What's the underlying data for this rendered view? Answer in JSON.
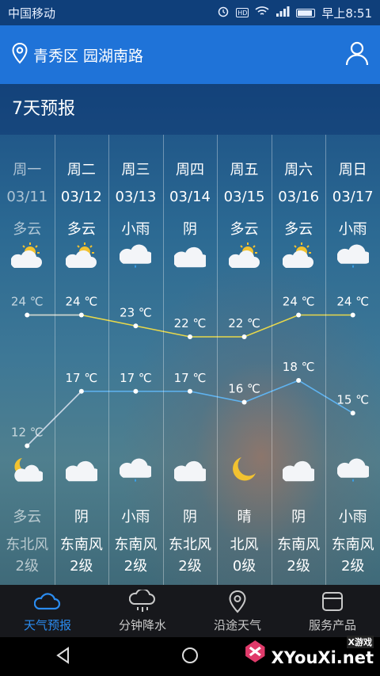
{
  "status": {
    "carrier": "中国移动",
    "time": "早上8:51"
  },
  "header": {
    "location": "青秀区 园湖南路"
  },
  "section_title": "7天预报",
  "days": [
    {
      "day": "周一",
      "date": "03/11",
      "cond": "多云",
      "icon": "partly-cloudy-icon",
      "high": "24 ℃",
      "low": "12 ℃",
      "night_cond": "多云",
      "night_icon": "moon-cloud-icon",
      "wind": "东北风",
      "level": "2级",
      "dim": true
    },
    {
      "day": "周二",
      "date": "03/12",
      "cond": "多云",
      "icon": "partly-cloudy-icon",
      "high": "24 ℃",
      "low": "17 ℃",
      "night_cond": "阴",
      "night_icon": "cloud-icon",
      "wind": "东南风",
      "level": "2级",
      "dim": false
    },
    {
      "day": "周三",
      "date": "03/13",
      "cond": "小雨",
      "icon": "rain-cloud-icon",
      "high": "23 ℃",
      "low": "17 ℃",
      "night_cond": "小雨",
      "night_icon": "rain-cloud-icon",
      "wind": "东南风",
      "level": "2级",
      "dim": false
    },
    {
      "day": "周四",
      "date": "03/14",
      "cond": "阴",
      "icon": "cloud-icon",
      "high": "22 ℃",
      "low": "17 ℃",
      "night_cond": "阴",
      "night_icon": "cloud-icon",
      "wind": "东北风",
      "level": "2级",
      "dim": false
    },
    {
      "day": "周五",
      "date": "03/15",
      "cond": "多云",
      "icon": "partly-cloudy-icon",
      "high": "22 ℃",
      "low": "16 ℃",
      "night_cond": "晴",
      "night_icon": "moon-icon",
      "wind": "北风",
      "level": "0级",
      "dim": false
    },
    {
      "day": "周六",
      "date": "03/16",
      "cond": "多云",
      "icon": "partly-cloudy-icon",
      "high": "24 ℃",
      "low": "18 ℃",
      "night_cond": "阴",
      "night_icon": "cloud-icon",
      "wind": "东南风",
      "level": "2级",
      "dim": false
    },
    {
      "day": "周日",
      "date": "03/17",
      "cond": "小雨",
      "icon": "rain-cloud-icon",
      "high": "24 ℃",
      "low": "15 ℃",
      "night_cond": "小雨",
      "night_icon": "rain-cloud-icon",
      "wind": "东南风",
      "level": "2级",
      "dim": false
    }
  ],
  "chart_data": {
    "type": "line",
    "categories": [
      "周一",
      "周二",
      "周三",
      "周四",
      "周五",
      "周六",
      "周日"
    ],
    "series": [
      {
        "values": [
          24,
          24,
          23,
          22,
          22,
          24,
          24
        ],
        "color": "#e8d84a"
      },
      {
        "values": [
          12,
          17,
          17,
          17,
          16,
          18,
          15
        ],
        "color": "#5fb3f0"
      }
    ],
    "ylim": [
      10,
      26
    ]
  },
  "tabs": [
    {
      "label": "天气预报",
      "icon": "weather-cloud-icon",
      "active": true
    },
    {
      "label": "分钟降水",
      "icon": "rain-cloud-icon",
      "active": false
    },
    {
      "label": "沿途天气",
      "icon": "location-pin-icon",
      "active": false
    },
    {
      "label": "服务产品",
      "icon": "box-icon",
      "active": false
    }
  ],
  "watermark": {
    "top": "X游戏",
    "main": "XYouXi.net"
  }
}
